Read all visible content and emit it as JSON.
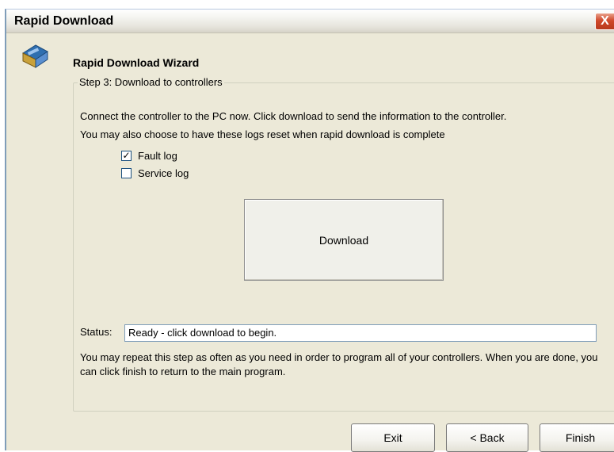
{
  "window": {
    "title": "Rapid Download",
    "close_glyph": "X"
  },
  "header": {
    "icon": "wizard-app-icon",
    "title": "Rapid Download Wizard"
  },
  "step": {
    "group_title": "Step 3: Download to controllers",
    "instruction_1": "Connect the controller to the PC now. Click download to send the information to the controller.",
    "instruction_2": "You may also choose to have these logs reset when rapid download is complete",
    "options": [
      {
        "label": "Fault log",
        "checked": true
      },
      {
        "label": "Service log",
        "checked": false
      }
    ],
    "download_label": "Download",
    "status_label": "Status:",
    "status_value": "Ready - click download to begin.",
    "info_text": "You may repeat this step as often as you need  in order to program all of your controllers. When you are done, you can click finish to return to the main program."
  },
  "footer": {
    "exit_label": "Exit",
    "back_label": "< Back",
    "finish_label": "Finish"
  },
  "colors": {
    "dialog_bg": "#ece9d8",
    "close_red": "#d0482a",
    "field_border": "#7f9db9"
  }
}
